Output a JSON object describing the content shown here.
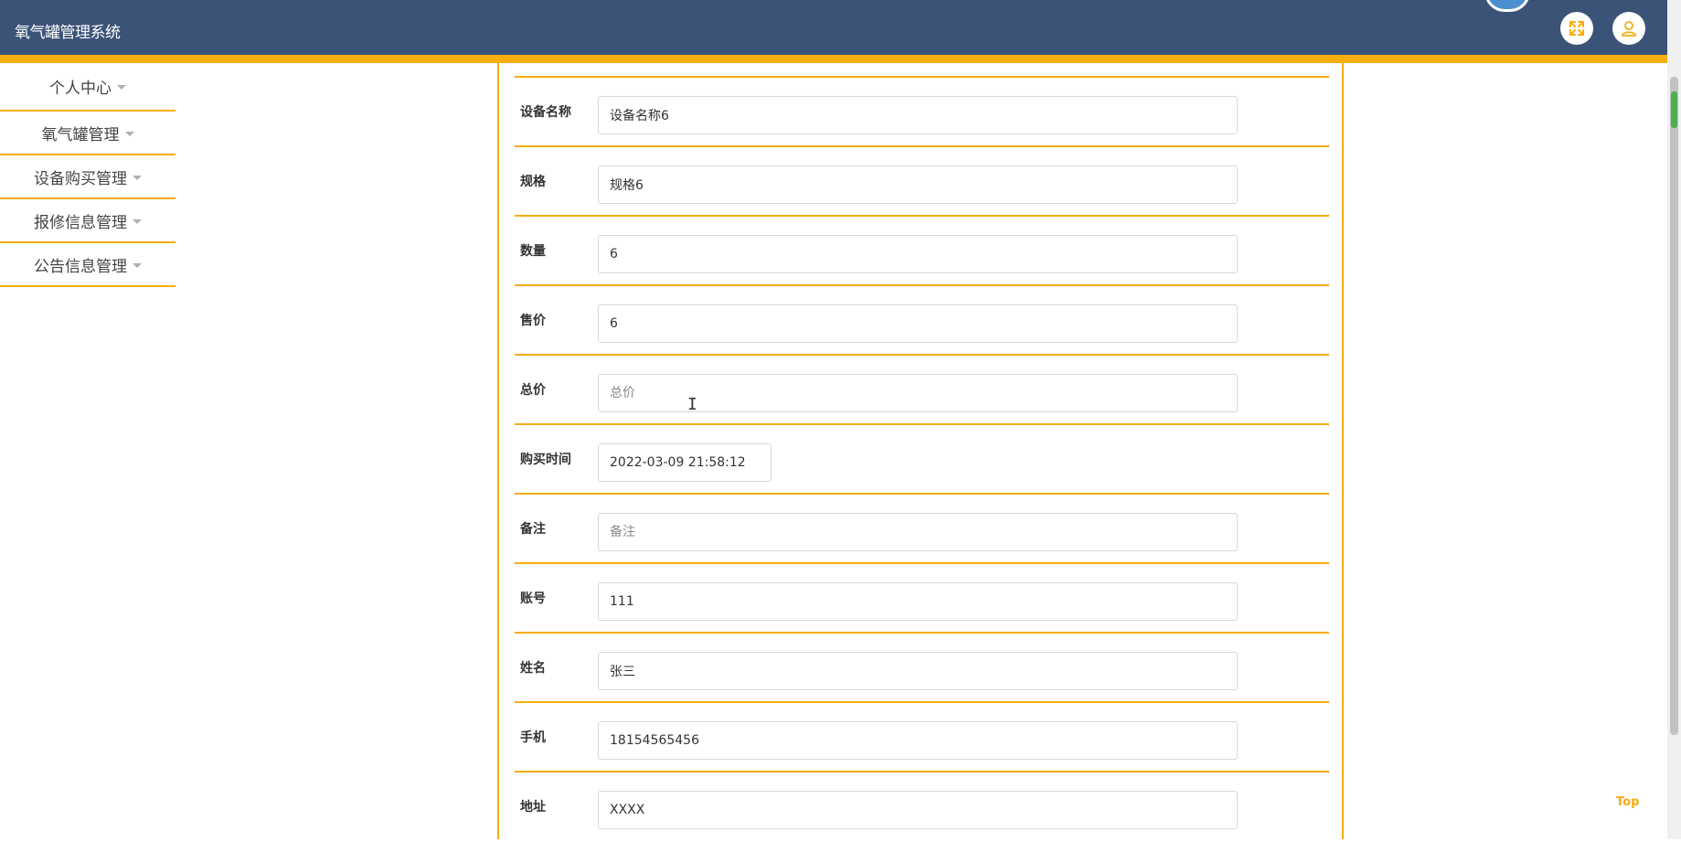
{
  "header": {
    "title": "氧气罐管理系统",
    "fullscreen_icon": "fullscreen-icon",
    "user_icon": "user-icon",
    "bg_color": "#3c5378",
    "accent_color": "#f6ad0f"
  },
  "sidebar": {
    "items": [
      {
        "label": "个人中心"
      },
      {
        "label": "氧气罐管理"
      },
      {
        "label": "设备购买管理"
      },
      {
        "label": "报修信息管理"
      },
      {
        "label": "公告信息管理"
      }
    ]
  },
  "form": {
    "fields": [
      {
        "label": "设备名称",
        "value": "设备名称6",
        "placeholder": "设备名称"
      },
      {
        "label": "规格",
        "value": "规格6",
        "placeholder": "规格"
      },
      {
        "label": "数量",
        "value": "6",
        "placeholder": "数量"
      },
      {
        "label": "售价",
        "value": "6",
        "placeholder": "售价"
      },
      {
        "label": "总价",
        "value": "",
        "placeholder": "总价"
      },
      {
        "label": "购买时间",
        "value": "2022-03-09 21:58:12",
        "placeholder": "购买时间"
      },
      {
        "label": "备注",
        "value": "",
        "placeholder": "备注"
      },
      {
        "label": "账号",
        "value": "111",
        "placeholder": "账号"
      },
      {
        "label": "姓名",
        "value": "张三",
        "placeholder": "姓名"
      },
      {
        "label": "手机",
        "value": "18154565456",
        "placeholder": "手机"
      },
      {
        "label": "地址",
        "value": "XXXX",
        "placeholder": "地址"
      }
    ]
  },
  "back_top": {
    "label": "Top"
  }
}
